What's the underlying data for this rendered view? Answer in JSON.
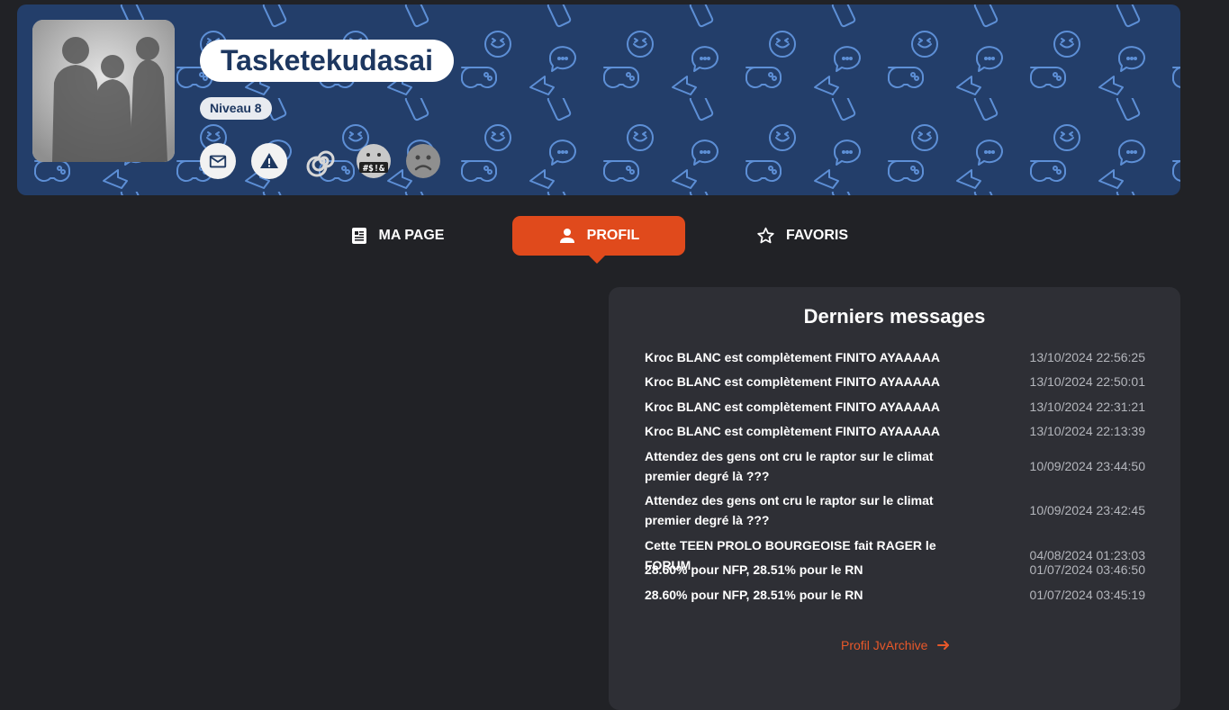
{
  "profile": {
    "username": "Tasketekudasai",
    "level": "Niveau 8",
    "icons": [
      "mail-icon",
      "warning-icon",
      "spiral-icon",
      "swearing-face-icon",
      "sad-face-icon"
    ]
  },
  "tabs": [
    {
      "label": "MA PAGE",
      "icon": "page-icon",
      "active": false
    },
    {
      "label": "PROFIL",
      "icon": "person-icon",
      "active": true
    },
    {
      "label": "FAVORIS",
      "icon": "star-icon",
      "active": false
    }
  ],
  "messages_panel": {
    "title": "Derniers messages",
    "rows": [
      {
        "title": "Kroc BLANC est complètement FINITO AYAAAAA",
        "date": "13/10/2024 22:56:25"
      },
      {
        "title": "Kroc BLANC est complètement FINITO AYAAAAA",
        "date": "13/10/2024 22:50:01"
      },
      {
        "title": "Kroc BLANC est complètement FINITO AYAAAAA",
        "date": "13/10/2024 22:31:21"
      },
      {
        "title": "Kroc BLANC est complètement FINITO AYAAAAA",
        "date": "13/10/2024 22:13:39"
      },
      {
        "title": "Attendez des gens ont cru le raptor sur le climat premier degré là ???",
        "date": "10/09/2024 23:44:50"
      },
      {
        "title": "Attendez des gens ont cru le raptor sur le climat premier degré là ???",
        "date": "10/09/2024 23:42:45"
      },
      {
        "title": "Cette TEEN PROLO BOURGEOISE fait RAGER le FORUM",
        "date": "04/08/2024 01:23:03"
      },
      {
        "title": "28.60% pour NFP, 28.51% pour le RN",
        "date": "01/07/2024 03:46:50"
      },
      {
        "title": "28.60% pour NFP, 28.51% pour le RN",
        "date": "01/07/2024 03:45:19"
      }
    ],
    "link_label": "Profil JvArchive"
  },
  "colors": {
    "banner": "#233e6a",
    "accent": "#e04a1c",
    "panel": "#2e2f35",
    "background": "#212226"
  }
}
